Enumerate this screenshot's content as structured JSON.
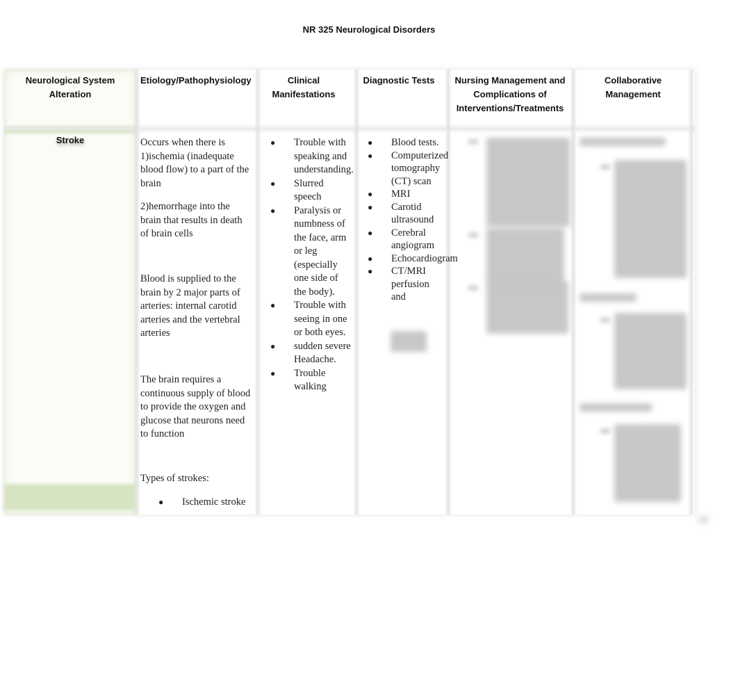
{
  "document": {
    "title": "NR 325 Neurological Disorders"
  },
  "table": {
    "headers": [
      "Neurological System Alteration",
      "Etiology/Pathophysiology",
      "Clinical Manifestations",
      "Diagnostic Tests",
      "Nursing Management and Complications of Interventions/Treatments",
      "Collaborative Management"
    ],
    "rows": [
      {
        "alteration": "Stroke",
        "etiology": {
          "paragraphs": [
            "Occurs when there is 1)ischemia (inadequate blood flow) to a part of the brain",
            "2)hemorrhage into the brain that results in death of brain cells",
            "Blood is supplied to the brain by 2 major parts of arteries: internal carotid arteries and the vertebral arteries",
            "The brain requires a continuous supply of blood to provide the oxygen and glucose that neurons need to function",
            "Types of strokes:"
          ],
          "stroke_types": [
            "Ischemic stroke"
          ]
        },
        "clinical_manifestations": [
          "Trouble with speaking and understanding.",
          "Slurred speech",
          "Paralysis or numbness of the face, arm or leg (especially one side of the body).",
          "Trouble with seeing in one or both eyes.",
          "sudden severe Headache.",
          "Trouble walking"
        ],
        "diagnostic_tests": [
          "Blood tests.",
          "Computerized tomography (CT) scan",
          "MRI",
          "Carotid ultrasound",
          "Cerebral angiogram",
          "Echocardiogram",
          "CT/MRI perfusion and"
        ],
        "nursing_management": "[blurred content]",
        "collaborative_management": "[blurred content]"
      }
    ]
  },
  "icons": {
    "bullet": "●"
  }
}
